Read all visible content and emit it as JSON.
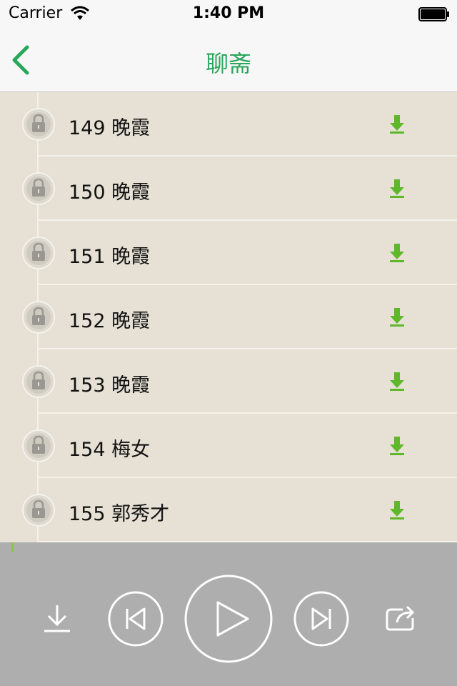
{
  "status_bar": {
    "carrier": "Carrier",
    "time": "1:40 PM"
  },
  "nav": {
    "title": "聊斋"
  },
  "episodes": [
    {
      "label": "149 晚霞"
    },
    {
      "label": "150 晚霞"
    },
    {
      "label": "151 晚霞"
    },
    {
      "label": "152 晚霞"
    },
    {
      "label": "153 晚霞"
    },
    {
      "label": "154 梅女"
    },
    {
      "label": "155 郭秀才"
    }
  ],
  "page_indicator": {
    "count": 2,
    "current": 1
  },
  "colors": {
    "accent_green": "#2aa65b",
    "download_green": "#5fb82a",
    "list_bg": "#e6e1d4",
    "player_bg": "#aeaeae"
  },
  "icons": {
    "back": "chevron-left-icon",
    "lock": "lock-icon",
    "row_download": "download-arrow-icon",
    "player_download": "download-icon",
    "prev": "skip-previous-icon",
    "play": "play-icon",
    "next": "skip-next-icon",
    "share": "share-icon"
  }
}
